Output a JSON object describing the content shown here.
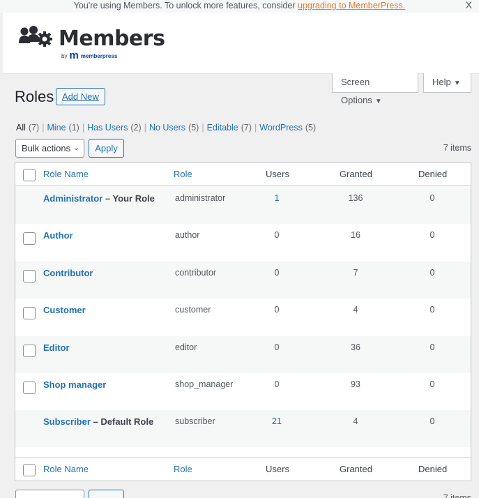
{
  "notice": {
    "text": "You're using Members. To unlock more features, consider ",
    "link": "upgrading to MemberPress.",
    "close": "X"
  },
  "brand": {
    "wordmark": "Members",
    "by": "by",
    "partner_mark": "m",
    "partner": "memberpress",
    "brand_color": "#06429e"
  },
  "header_tabs": {
    "screen_options": "Screen Options",
    "help": "Help"
  },
  "page": {
    "title": "Roles",
    "add_new": "Add New"
  },
  "views": [
    {
      "label": "All",
      "count": "(7)",
      "current": true
    },
    {
      "label": "Mine",
      "count": "(1)"
    },
    {
      "label": "Has Users",
      "count": "(2)"
    },
    {
      "label": "No Users",
      "count": "(5)"
    },
    {
      "label": "Editable",
      "count": "(7)"
    },
    {
      "label": "WordPress",
      "count": "(5)"
    }
  ],
  "views_separator": "|",
  "bulk": {
    "label": "Bulk actions",
    "apply": "Apply",
    "count": "7 items"
  },
  "columns": {
    "role_name": "Role Name",
    "role": "Role",
    "users": "Users",
    "granted": "Granted",
    "denied": "Denied"
  },
  "rows": [
    {
      "name": "Administrator",
      "suffix": " – Your Role",
      "role": "administrator",
      "users": "1",
      "granted": "136",
      "denied": "0",
      "checkbox": false,
      "users_link": true
    },
    {
      "name": "Author",
      "suffix": "",
      "role": "author",
      "users": "0",
      "granted": "16",
      "denied": "0",
      "checkbox": true,
      "users_link": false
    },
    {
      "name": "Contributor",
      "suffix": "",
      "role": "contributor",
      "users": "0",
      "granted": "7",
      "denied": "0",
      "checkbox": true,
      "users_link": false
    },
    {
      "name": "Customer",
      "suffix": "",
      "role": "customer",
      "users": "0",
      "granted": "4",
      "denied": "0",
      "checkbox": true,
      "users_link": false
    },
    {
      "name": "Editor",
      "suffix": "",
      "role": "editor",
      "users": "0",
      "granted": "36",
      "denied": "0",
      "checkbox": true,
      "users_link": false
    },
    {
      "name": "Shop manager",
      "suffix": "",
      "role": "shop_manager",
      "users": "0",
      "granted": "93",
      "denied": "0",
      "checkbox": true,
      "users_link": false
    },
    {
      "name": "Subscriber",
      "suffix": " – Default Role",
      "role": "subscriber",
      "users": "21",
      "granted": "4",
      "denied": "0",
      "checkbox": false,
      "users_link": true
    }
  ],
  "colors": {
    "link": "#2271b1",
    "notice_link": "#e37b27"
  }
}
